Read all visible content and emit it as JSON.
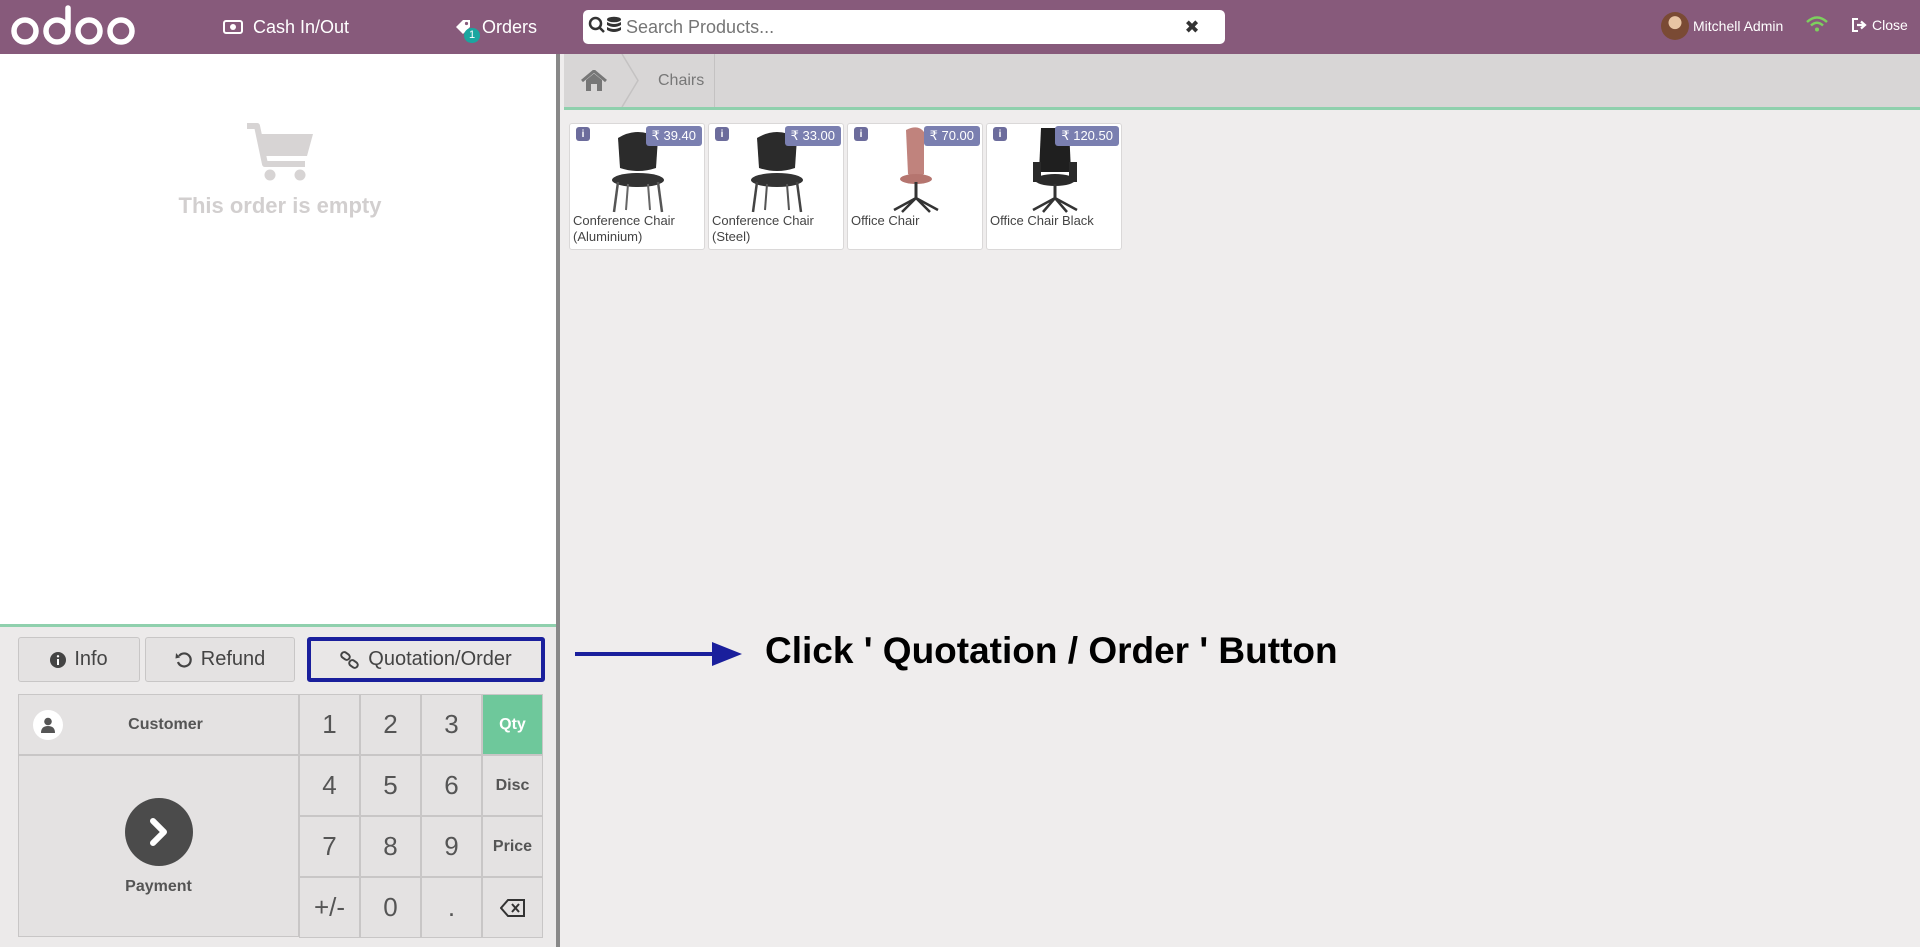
{
  "topbar": {
    "cash_label": "Cash In/Out",
    "orders_label": "Orders",
    "orders_badge": "1",
    "search_placeholder": "Search Products...",
    "user_name": "Mitchell Admin",
    "close_label": "Close"
  },
  "order": {
    "empty_text": "This order is empty"
  },
  "actions": {
    "info": "Info",
    "refund": "Refund",
    "quotation": "Quotation/Order"
  },
  "pad": {
    "customer": "Customer",
    "payment": "Payment",
    "keys": [
      "1",
      "2",
      "3",
      "Qty",
      "4",
      "5",
      "6",
      "Disc",
      "7",
      "8",
      "9",
      "Price",
      "+/-",
      "0",
      "."
    ],
    "active_mode": "Qty"
  },
  "breadcrumb": {
    "category": "Chairs"
  },
  "products": [
    {
      "name": "Conference Chair (Aluminium)",
      "price": "₹ 39.40"
    },
    {
      "name": "Conference Chair (Steel)",
      "price": "₹ 33.00"
    },
    {
      "name": "Office Chair",
      "price": "₹ 70.00"
    },
    {
      "name": "Office Chair Black",
      "price": "₹ 120.50"
    }
  ],
  "annotation": {
    "text": "Click ' Quotation / Order ' Button"
  },
  "colors": {
    "brand": "#875a7b",
    "accent": "#6ec89b",
    "highlight": "#1a1f9c",
    "price_tag": "#7a7fb0"
  }
}
